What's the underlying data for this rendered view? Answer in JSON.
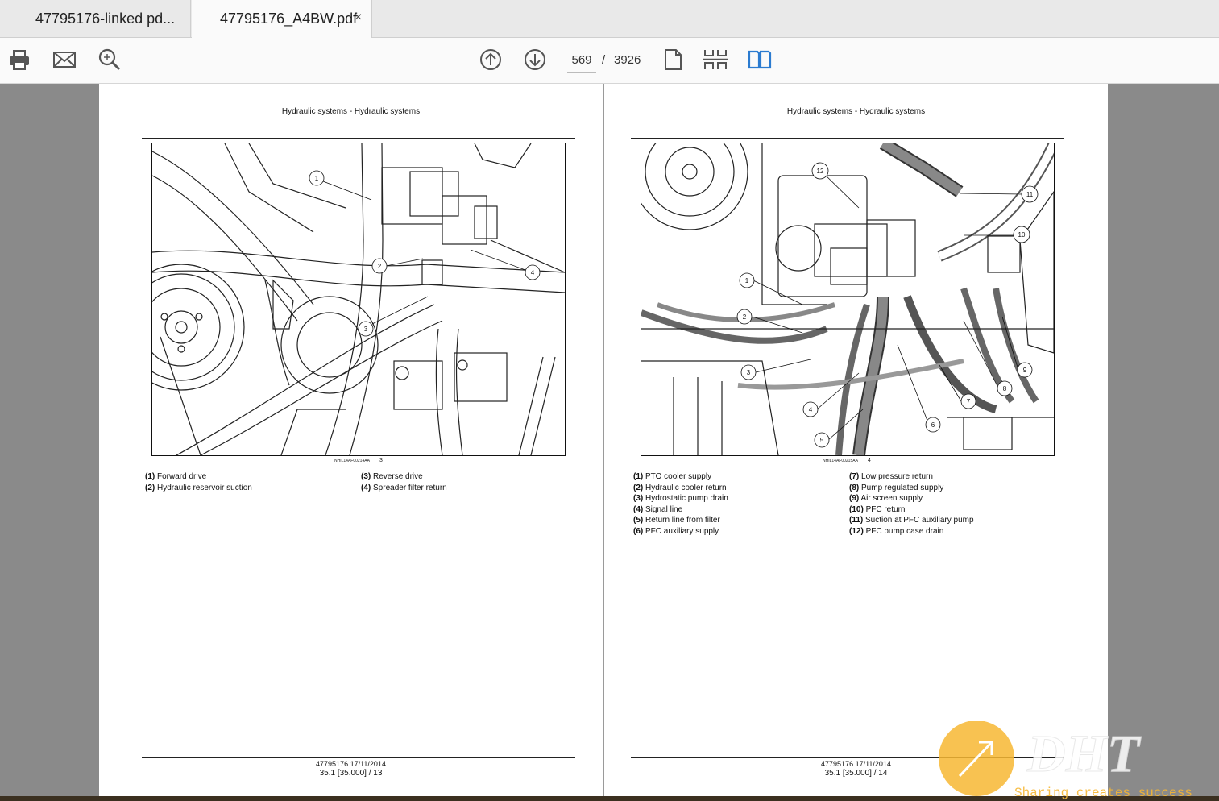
{
  "tabs": [
    {
      "label": "47795176-linked pd..."
    },
    {
      "label": "47795176_A4BW.pdf",
      "close": "×"
    }
  ],
  "toolbar": {
    "page_current": "569",
    "page_sep": "/",
    "page_total": "3926",
    "icons": [
      "print-icon",
      "mail-icon",
      "zoom-icon",
      "page-up-icon",
      "page-down-icon",
      "single-page-icon",
      "two-page-scroll-icon",
      "two-page-view-icon"
    ],
    "accent": "#2b7bd0"
  },
  "left_page": {
    "header": "Hydraulic systems - Hydraulic systems",
    "figure_id": "NHIL14AF00214AA",
    "figure_num": "3",
    "callouts": [
      "1",
      "2",
      "3",
      "4"
    ],
    "captions": [
      {
        "num": "(1)",
        "text": "Forward drive"
      },
      {
        "num": "(2)",
        "text": "Hydraulic reservoir suction"
      },
      {
        "num": "(3)",
        "text": "Reverse drive"
      },
      {
        "num": "(4)",
        "text": "Spreader filter return"
      }
    ],
    "footer_line1": "47795176 17/11/2014",
    "footer_line2": "35.1 [35.000] / 13"
  },
  "right_page": {
    "header": "Hydraulic systems - Hydraulic systems",
    "figure_id": "NHIL14AF00215AA",
    "figure_num": "4",
    "callouts": [
      "1",
      "2",
      "3",
      "4",
      "5",
      "6",
      "7",
      "8",
      "9",
      "10",
      "11",
      "12"
    ],
    "captions": [
      {
        "num": "(1)",
        "text": "PTO cooler supply"
      },
      {
        "num": "(2)",
        "text": "Hydraulic cooler return"
      },
      {
        "num": "(3)",
        "text": "Hydrostatic pump drain"
      },
      {
        "num": "(4)",
        "text": "Signal line"
      },
      {
        "num": "(5)",
        "text": "Return line from filter"
      },
      {
        "num": "(6)",
        "text": "PFC auxiliary supply"
      },
      {
        "num": "(7)",
        "text": "Low pressure return"
      },
      {
        "num": "(8)",
        "text": "Pump regulated supply"
      },
      {
        "num": "(9)",
        "text": "Air screen supply"
      },
      {
        "num": "(10)",
        "text": "PFC return"
      },
      {
        "num": "(11)",
        "text": "Suction at PFC auxiliary pump"
      },
      {
        "num": "(12)",
        "text": "PFC pump case drain"
      }
    ],
    "footer_line1": "47795176 17/11/2014",
    "footer_line2": "35.1 [35.000] / 14"
  },
  "watermark": {
    "brand": "DHT",
    "slogan": "Sharing creates success",
    "color": "#f7b733"
  }
}
